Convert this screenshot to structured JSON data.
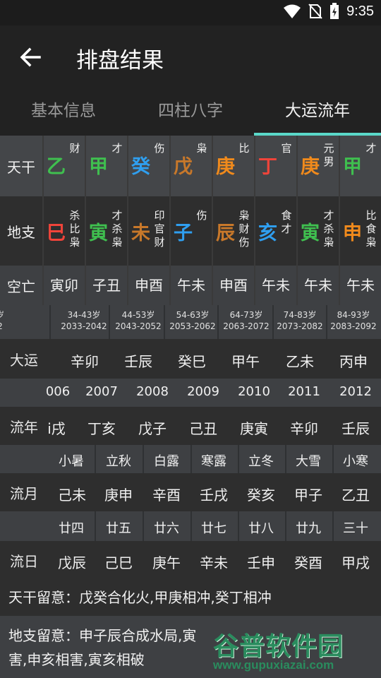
{
  "status": {
    "time": "9:35"
  },
  "app": {
    "title": "排盘结果"
  },
  "tabs": [
    {
      "label": "基本信息"
    },
    {
      "label": "四柱八字"
    },
    {
      "label": "大运流年"
    }
  ],
  "colors": {
    "wood": "#3fbf4f",
    "fire": "#f0443a",
    "earth": "#e07a10",
    "metal": "#f08a1c",
    "water": "#2f9ff0",
    "accent": "#5ad8c9",
    "wei": "#c8782a"
  },
  "pillars": {
    "tiangan_label": "天干",
    "dizhi_label": "地支",
    "kongwang_label": "空亡",
    "tiangan": [
      {
        "char": "乙",
        "note": "财",
        "color": "#3fbf4f"
      },
      {
        "char": "甲",
        "note": "才",
        "color": "#3fbf4f"
      },
      {
        "char": "癸",
        "note": "伤",
        "color": "#2f9ff0"
      },
      {
        "char": "戊",
        "note": "枭",
        "color": "#c8782a"
      },
      {
        "char": "庚",
        "note": "比",
        "color": "#f08a1c"
      },
      {
        "char": "丁",
        "note": "官",
        "color": "#f0443a"
      },
      {
        "char": "庚",
        "note": "元男",
        "color": "#f08a1c"
      },
      {
        "char": "甲",
        "note": "才",
        "color": "#3fbf4f"
      }
    ],
    "dizhi": [
      {
        "char": "巳",
        "note": "杀比枭",
        "color": "#f0443a"
      },
      {
        "char": "寅",
        "note": "才杀枭",
        "color": "#3fbf4f"
      },
      {
        "char": "未",
        "note": "印官财",
        "color": "#c8782a"
      },
      {
        "char": "子",
        "note": "伤",
        "color": "#2f9ff0"
      },
      {
        "char": "辰",
        "note": "枭财伤",
        "color": "#c8782a"
      },
      {
        "char": "亥",
        "note": "食才",
        "color": "#2f9ff0"
      },
      {
        "char": "寅",
        "note": "才杀枭",
        "color": "#3fbf4f"
      },
      {
        "char": "申",
        "note": "比食枭",
        "color": "#f08a1c"
      }
    ],
    "kongwang": [
      "寅卯",
      "子丑",
      "申酉",
      "午未",
      "申酉",
      "午未",
      "午未",
      "午未"
    ]
  },
  "dayun": {
    "label": "大运",
    "ages": [
      {
        "age": "岁",
        "years": "2"
      },
      {
        "age": "34-43岁",
        "years": "2033-2042"
      },
      {
        "age": "44-53岁",
        "years": "2043-2052"
      },
      {
        "age": "54-63岁",
        "years": "2053-2062"
      },
      {
        "age": "64-73岁",
        "years": "2063-2072"
      },
      {
        "age": "74-83岁",
        "years": "2073-2082"
      },
      {
        "age": "84-93岁",
        "years": "2083-2092"
      }
    ],
    "items": [
      "辛卯",
      "壬辰",
      "癸巳",
      "甲午",
      "乙未",
      "丙申"
    ]
  },
  "liunian": {
    "label": "流年",
    "years": [
      "006",
      "2007",
      "2008",
      "2009",
      "2010",
      "2011",
      "2012"
    ],
    "items": [
      "i戌",
      "丁亥",
      "戊子",
      "己丑",
      "庚寅",
      "辛卯",
      "壬辰"
    ]
  },
  "liuyue": {
    "label": "流月",
    "jieqi": [
      "小暑",
      "立秋",
      "白露",
      "寒露",
      "立冬",
      "大雪",
      "小寒"
    ],
    "items": [
      "己未",
      "庚申",
      "辛酉",
      "壬戌",
      "癸亥",
      "甲子",
      "乙丑"
    ]
  },
  "liuri": {
    "label": "流日",
    "lunar": [
      "廿四",
      "廿五",
      "廿六",
      "廿七",
      "廿八",
      "廿九",
      "三十"
    ],
    "items": [
      "戊辰",
      "己巳",
      "庚午",
      "辛未",
      "壬申",
      "癸酉",
      "甲戌"
    ]
  },
  "notes": {
    "tiangan": "天干留意：戊癸合化火,甲庚相冲,癸丁相冲",
    "dizhi_line1": "地支留意：申子辰合成水局,寅",
    "dizhi_line2": "害,申亥相害,寅亥相破"
  },
  "watermark": {
    "cn": "谷普软件园",
    "url": "www.gupuxiazai.com"
  }
}
